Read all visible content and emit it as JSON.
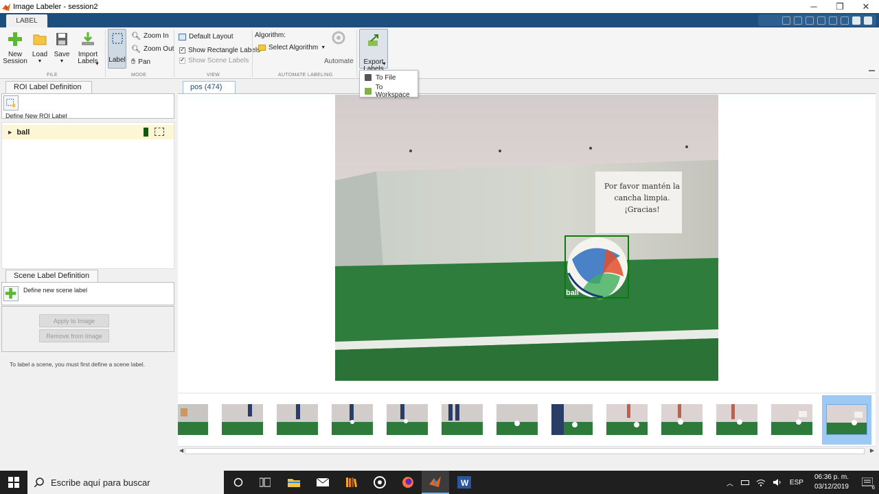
{
  "window": {
    "title": "Image Labeler - session2",
    "controls": [
      "─",
      "❐",
      "✕"
    ]
  },
  "tabs": {
    "active": "LABEL"
  },
  "ribbon": {
    "file": {
      "new_session": "New\nSession",
      "load": "Load",
      "save": "Save",
      "import_labels": "Import\nLabels",
      "group": "FILE"
    },
    "mode": {
      "label": "Label",
      "zoom_in": "Zoom In",
      "zoom_out": "Zoom Out",
      "pan": "Pan",
      "group": "MODE"
    },
    "view": {
      "default_layout": "Default Layout",
      "show_rect_labels": "Show Rectangle Labels",
      "show_scene_labels": "Show Scene Labels",
      "group": "VIEW"
    },
    "automate": {
      "algorithm_label": "Algorithm:",
      "select_algorithm": "Select Algorithm",
      "automate": "Automate",
      "group": "AUTOMATE LABELING"
    },
    "export": {
      "export_labels": "Export\nLabels",
      "menu": [
        "To File",
        "To Workspace"
      ]
    }
  },
  "left_panel": {
    "roi_tab": "ROI Label Definition",
    "define_roi": "Define New ROI Label",
    "roi_labels": [
      {
        "name": "ball",
        "color": "#0a5c0a"
      }
    ],
    "scene_tab": "Scene Label Definition",
    "define_scene": "Define new scene label",
    "apply_btn": "Apply to Image",
    "remove_btn": "Remove from Image",
    "hint": "To label a scene, you must first define a scene label."
  },
  "main": {
    "image_tab": "pos (474)",
    "sign_lines": [
      "Por favor mantén la",
      "cancha limpia.",
      "¡Gracias!"
    ],
    "bbox_label": "ball",
    "thumbnail_count": 13
  },
  "taskbar": {
    "search_placeholder": "Escribe aquí para buscar",
    "lang": "ESP",
    "time": "06:36 p. m.",
    "date": "03/12/2019",
    "notification_count": "6"
  },
  "colors": {
    "accent": "#1d4e7d",
    "bbox": "#0a7a0a",
    "selected_thumb": "#9ccaf5"
  }
}
